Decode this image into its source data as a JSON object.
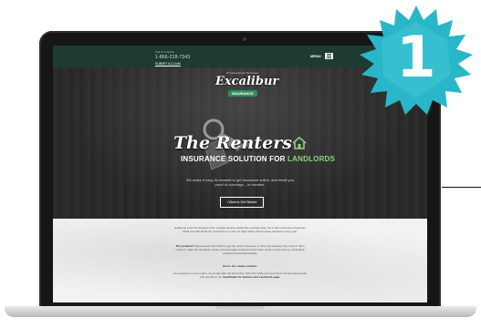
{
  "step_badge": {
    "number": "1",
    "color": "#29b6c9"
  },
  "site": {
    "topbar": {
      "call_label": "Call for a Quote",
      "phone": "1-866-218-7343",
      "claim_link": "SUBMIT A CLAIM",
      "menu_label": "MENU"
    },
    "logo": {
      "tagline": "Professional Services",
      "name": "Excalibur",
      "sub": "INSURANCE"
    },
    "hero": {
      "headline_line1": "The Renters",
      "headline_line2_pre": "INSURANCE SOLUTION FOR ",
      "headline_line2_accent": "LANDLORDS",
      "description": "We make it easy for tenants to get insurance online, and email you proof of coverage – in minutes.",
      "cta_label": "I Want to Get Started"
    },
    "content": {
      "p1": "Gathering proof of insurance from multiple renters exactly like a simple task, but it often becomes a forgotten detail lost with landlords. Insurance is a part our daily duties and increase tolerance every year.",
      "p2_bold": "The problem?",
      "p2": "Most tenants don't think to get the renter insurance, or they don't believe they need it. Most needs to make the landlords create a full coverage email and send when renters check pricing, eliminating confusion and tenant liability.",
      "p3_bold": "Here's the simple solution.",
      "p4_pre": "As a service to your renters, we simply alter the link below. Fill in the fields and send them the formatted email with the link to our ",
      "p4_bold": "InstaShield for Renters and Landlords page."
    },
    "colors": {
      "topbar": "#1d3a33",
      "accent_green": "#8fd27f"
    }
  }
}
